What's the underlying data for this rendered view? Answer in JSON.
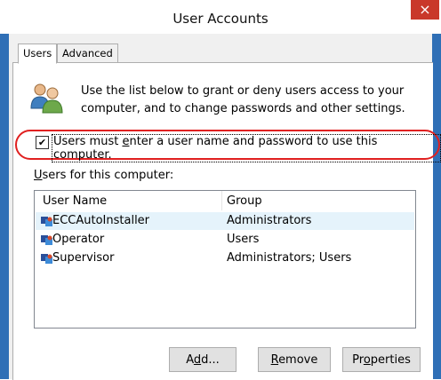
{
  "window": {
    "title": "User Accounts",
    "close_glyph": "×"
  },
  "tabs": [
    {
      "label": "Users"
    },
    {
      "label": "Advanced"
    }
  ],
  "description": "Use the list below to grant or deny users access to your computer, and to change passwords and other settings.",
  "checkbox": {
    "checked": true,
    "pre": "Users must ",
    "mnemonic": "e",
    "post": "nter a user name and password to use this computer."
  },
  "users_label": {
    "mnemonic": "U",
    "rest": "sers for this computer:"
  },
  "list": {
    "columns": [
      "User Name",
      "Group"
    ],
    "rows": [
      {
        "name": "ECCAutoInstaller",
        "group": "Administrators",
        "icon": "user-account-icon"
      },
      {
        "name": "Operator",
        "group": "Users",
        "icon": "user-account-icon"
      },
      {
        "name": "Supervisor",
        "group": "Administrators; Users",
        "icon": "user-account-icon"
      }
    ]
  },
  "buttons": {
    "add": {
      "pre": "A",
      "mnemonic": "d",
      "post": "d..."
    },
    "remove": {
      "pre": "",
      "mnemonic": "R",
      "post": "emove"
    },
    "properties": {
      "pre": "Pr",
      "mnemonic": "o",
      "post": "perties"
    }
  },
  "colors": {
    "titlebar_border": "#2f6fb6",
    "close": "#c9382a",
    "highlight": "#e02020",
    "selected_row": "#e5f3fb"
  }
}
